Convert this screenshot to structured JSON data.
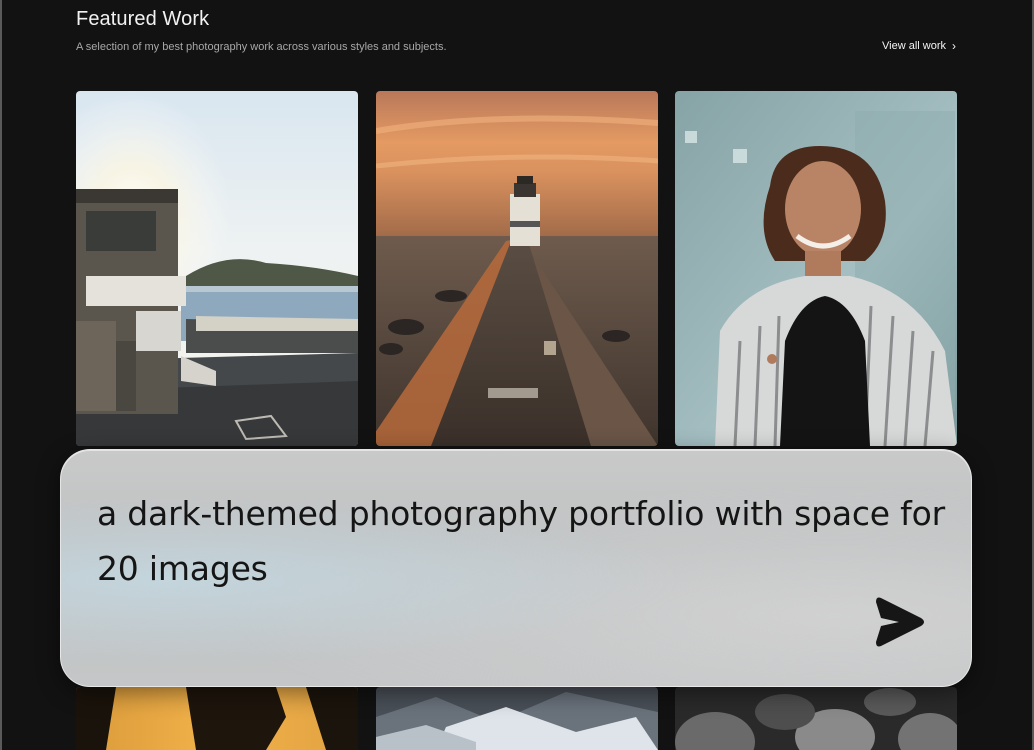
{
  "header": {
    "title": "Featured Work",
    "subtitle": "A selection of my best photography work across various styles and subjects.",
    "view_all_label": "View all work"
  },
  "gallery": {
    "images": [
      {
        "subject": "seaside villa at sunset"
      },
      {
        "subject": "lighthouse pier at dusk"
      },
      {
        "subject": "smiling woman portrait"
      },
      {
        "subject": "silhouette at sunset"
      },
      {
        "subject": "snowy rocks"
      },
      {
        "subject": "stone spheres"
      }
    ]
  },
  "prompt": {
    "text": "a dark-themed photography portfolio with space for 20 images"
  },
  "colors": {
    "background": "#121212",
    "text": "#ffffff",
    "muted_text": "#a8a8a8",
    "prompt_text": "#151515"
  }
}
